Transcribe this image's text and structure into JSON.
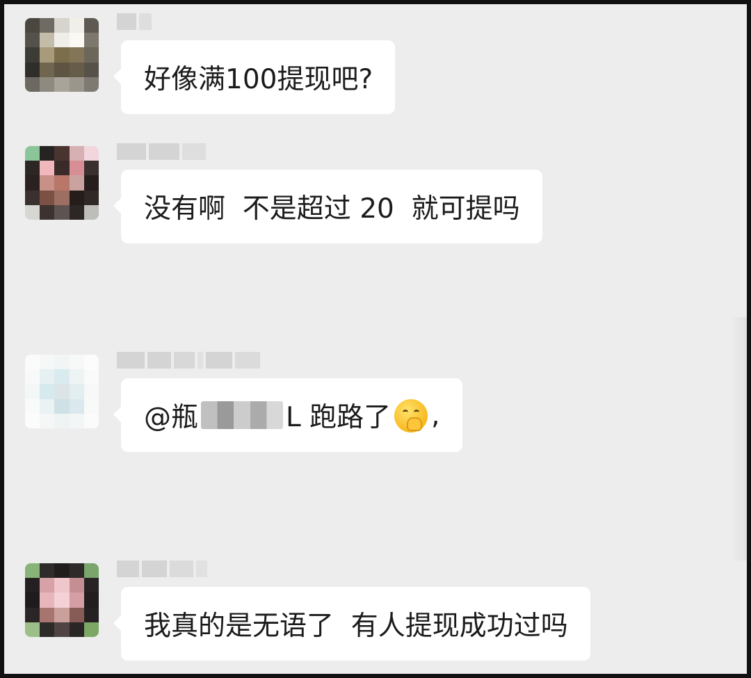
{
  "conversation": {
    "messages": [
      {
        "avatar_label": "",
        "text_before_redaction": "好像满100提现吧?",
        "text_after_redaction": ""
      },
      {
        "avatar_label": "",
        "text_before_redaction": "没有啊  不是超过 20  就可提吗",
        "text_after_redaction": ""
      },
      {
        "avatar_label": "",
        "text_before_redaction": "@瓶",
        "text_after_redaction": "L 跑路了",
        "emoji_icon": "hand-over-mouth-face-icon",
        "text_tail": ","
      },
      {
        "avatar_label": "",
        "text_before_redaction": "我真的是无语了  有人提现成功过吗",
        "text_after_redaction": ""
      }
    ]
  },
  "colors": {
    "background": "#ededed",
    "bubble": "#ffffff",
    "text": "#1b1b1b"
  }
}
